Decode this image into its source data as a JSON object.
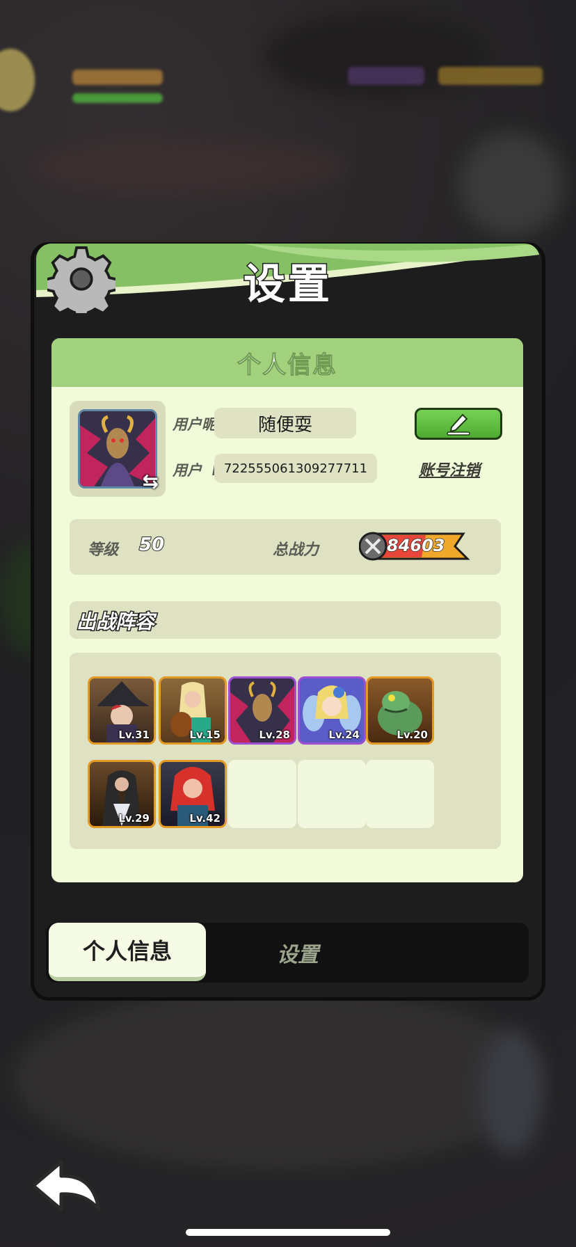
{
  "panel": {
    "title": "设置",
    "section_title": "个人信息"
  },
  "profile": {
    "nickname_label": "用户昵称",
    "nickname": "随便耍",
    "id_label": "用户  ID",
    "user_id": "722555061309277711",
    "cancel_account": "账号注销"
  },
  "stats": {
    "level_label": "等级",
    "level": "50",
    "power_label": "总战力",
    "power": "84603"
  },
  "lineup": {
    "title": "出战阵容",
    "heroes": [
      {
        "level": "Lv.31",
        "name": "witch-hero"
      },
      {
        "level": "Lv.15",
        "name": "bard-hero"
      },
      {
        "level": "Lv.28",
        "name": "goat-demon-hero"
      },
      {
        "level": "Lv.24",
        "name": "fairy-hero"
      },
      {
        "level": "Lv.20",
        "name": "toad-hero"
      },
      {
        "level": "Lv.29",
        "name": "dark-mage-hero"
      },
      {
        "level": "Lv.42",
        "name": "red-hair-hero"
      }
    ]
  },
  "tabs": {
    "active": "个人信息",
    "inactive": "设置"
  },
  "colors": {
    "accent_green": "#a2d27e",
    "card_bg": "#f1fbd9",
    "rarity_orange": "#e39a25",
    "rarity_purple": "#9d4fd3"
  }
}
